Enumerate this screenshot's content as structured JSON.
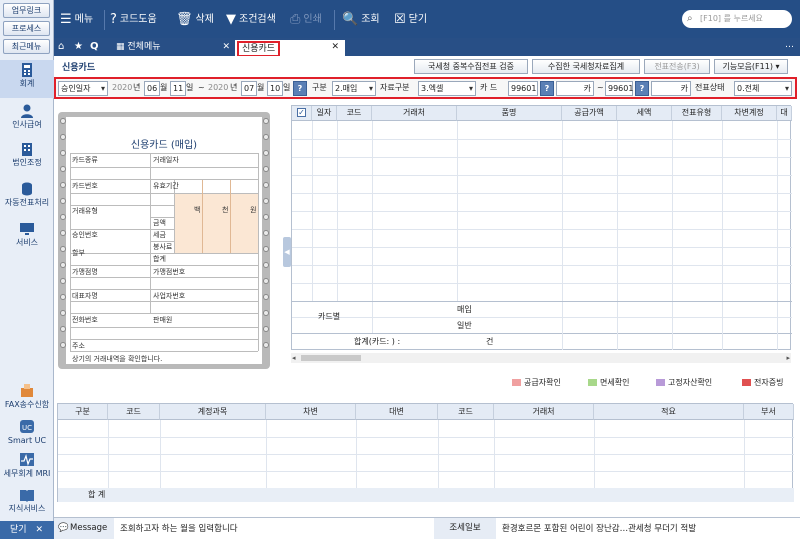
{
  "sidebar": {
    "quick_buttons": [
      "업무링크",
      "프로세스",
      "최근메뉴"
    ],
    "items": [
      {
        "label": "회계",
        "icon": "calculator-icon"
      },
      {
        "label": "인사급여",
        "icon": "person-icon"
      },
      {
        "label": "법인조정",
        "icon": "building-icon"
      },
      {
        "label": "자동전표처리",
        "icon": "database-icon"
      },
      {
        "label": "서비스",
        "icon": "monitor-icon"
      },
      {
        "label": "FAX송수신함",
        "icon": "fax-icon"
      },
      {
        "label": "Smart UC",
        "icon": "uc-icon"
      },
      {
        "label": "세무회계 MRI",
        "icon": "pulse-icon"
      },
      {
        "label": "지식서비스",
        "icon": "book-icon"
      }
    ],
    "close_label": "닫기"
  },
  "toolbar": {
    "menu": "메뉴",
    "code_help": "코드도움",
    "delete": "삭제",
    "condition_search": "조건검색",
    "print": "인쇄",
    "query": "조회",
    "close": "닫기",
    "search_placeholder": "[F10] 를 누르세요"
  },
  "tabs": {
    "all_menu": "전체메뉴",
    "active": "신용카드"
  },
  "page": {
    "title": "신용카드",
    "buttons": [
      "국세청 중복수집전표 검증",
      "수집한 국세청자료집계",
      "전표전송(F3)",
      "기능모음(F11)"
    ]
  },
  "filter": {
    "date_type": "승인일자",
    "from_year": "2020",
    "year_label": "년",
    "from_month": "06",
    "month_label": "월",
    "from_day": "11",
    "day_label": "일",
    "tilde": "~",
    "to_year": "2020",
    "to_month": "07",
    "to_day": "10",
    "help": "?",
    "category_label": "구분",
    "category_value": "2.매입",
    "data_type_label": "자료구분",
    "data_type_value": "3.엑셀",
    "card_label": "카 드",
    "card_from": "99601",
    "card_from_name": "카",
    "card_to": "99601",
    "card_to_name": "카",
    "slip_status_label": "전표상태",
    "slip_status_value": "0.전체"
  },
  "receipt": {
    "title": "신용카드 (매입)",
    "card_type": "카드종류",
    "trade_date": "거래일자",
    "card_no": "카드번호",
    "valid_period": "유효기간",
    "trade_type": "거래유형",
    "hundred_thousand": "백",
    "thousand": "천",
    "won": "원",
    "amount": "금액",
    "tax": "세금",
    "approval_no": "승인번호",
    "service_fee": "봉사료",
    "installment": "할부",
    "total": "합계",
    "merchant_name": "가맹점명",
    "merchant_no": "가맹점번호",
    "ceo": "대표자명",
    "biz_no": "사업자번호",
    "phone": "전화번호",
    "seller": "판매원",
    "address": "주소",
    "confirm": "상기의 거래내역을 확인합니다."
  },
  "grid": {
    "headers": [
      "일자",
      "코드",
      "거래처",
      "품명",
      "공급가액",
      "세액",
      "전표유형",
      "차변계정",
      "대"
    ],
    "summary_card": "카드별",
    "summary_purchase": "매입",
    "summary_general": "일반",
    "total_text": "합계(카드:     )   :",
    "count_unit": "건"
  },
  "legend": [
    {
      "label": "공급자확인",
      "color": "#f0a0a0"
    },
    {
      "label": "면세확인",
      "color": "#a8d88a"
    },
    {
      "label": "고정자산확인",
      "color": "#b89ad8"
    },
    {
      "label": "전자증빙",
      "color": "#e05050"
    }
  ],
  "journal": {
    "headers": [
      "구분",
      "코드",
      "계정과목",
      "차변",
      "대변",
      "코드",
      "거래처",
      "적요",
      "부서"
    ],
    "total_label": "합       계"
  },
  "status": {
    "message_label": "Message",
    "message_placeholder": "조회하고자 하는 월을 입력합니다",
    "news_label": "조세일보",
    "news_text": "환경호르몬 포함된 어린이 장난감…관세청 무더기 적발"
  }
}
